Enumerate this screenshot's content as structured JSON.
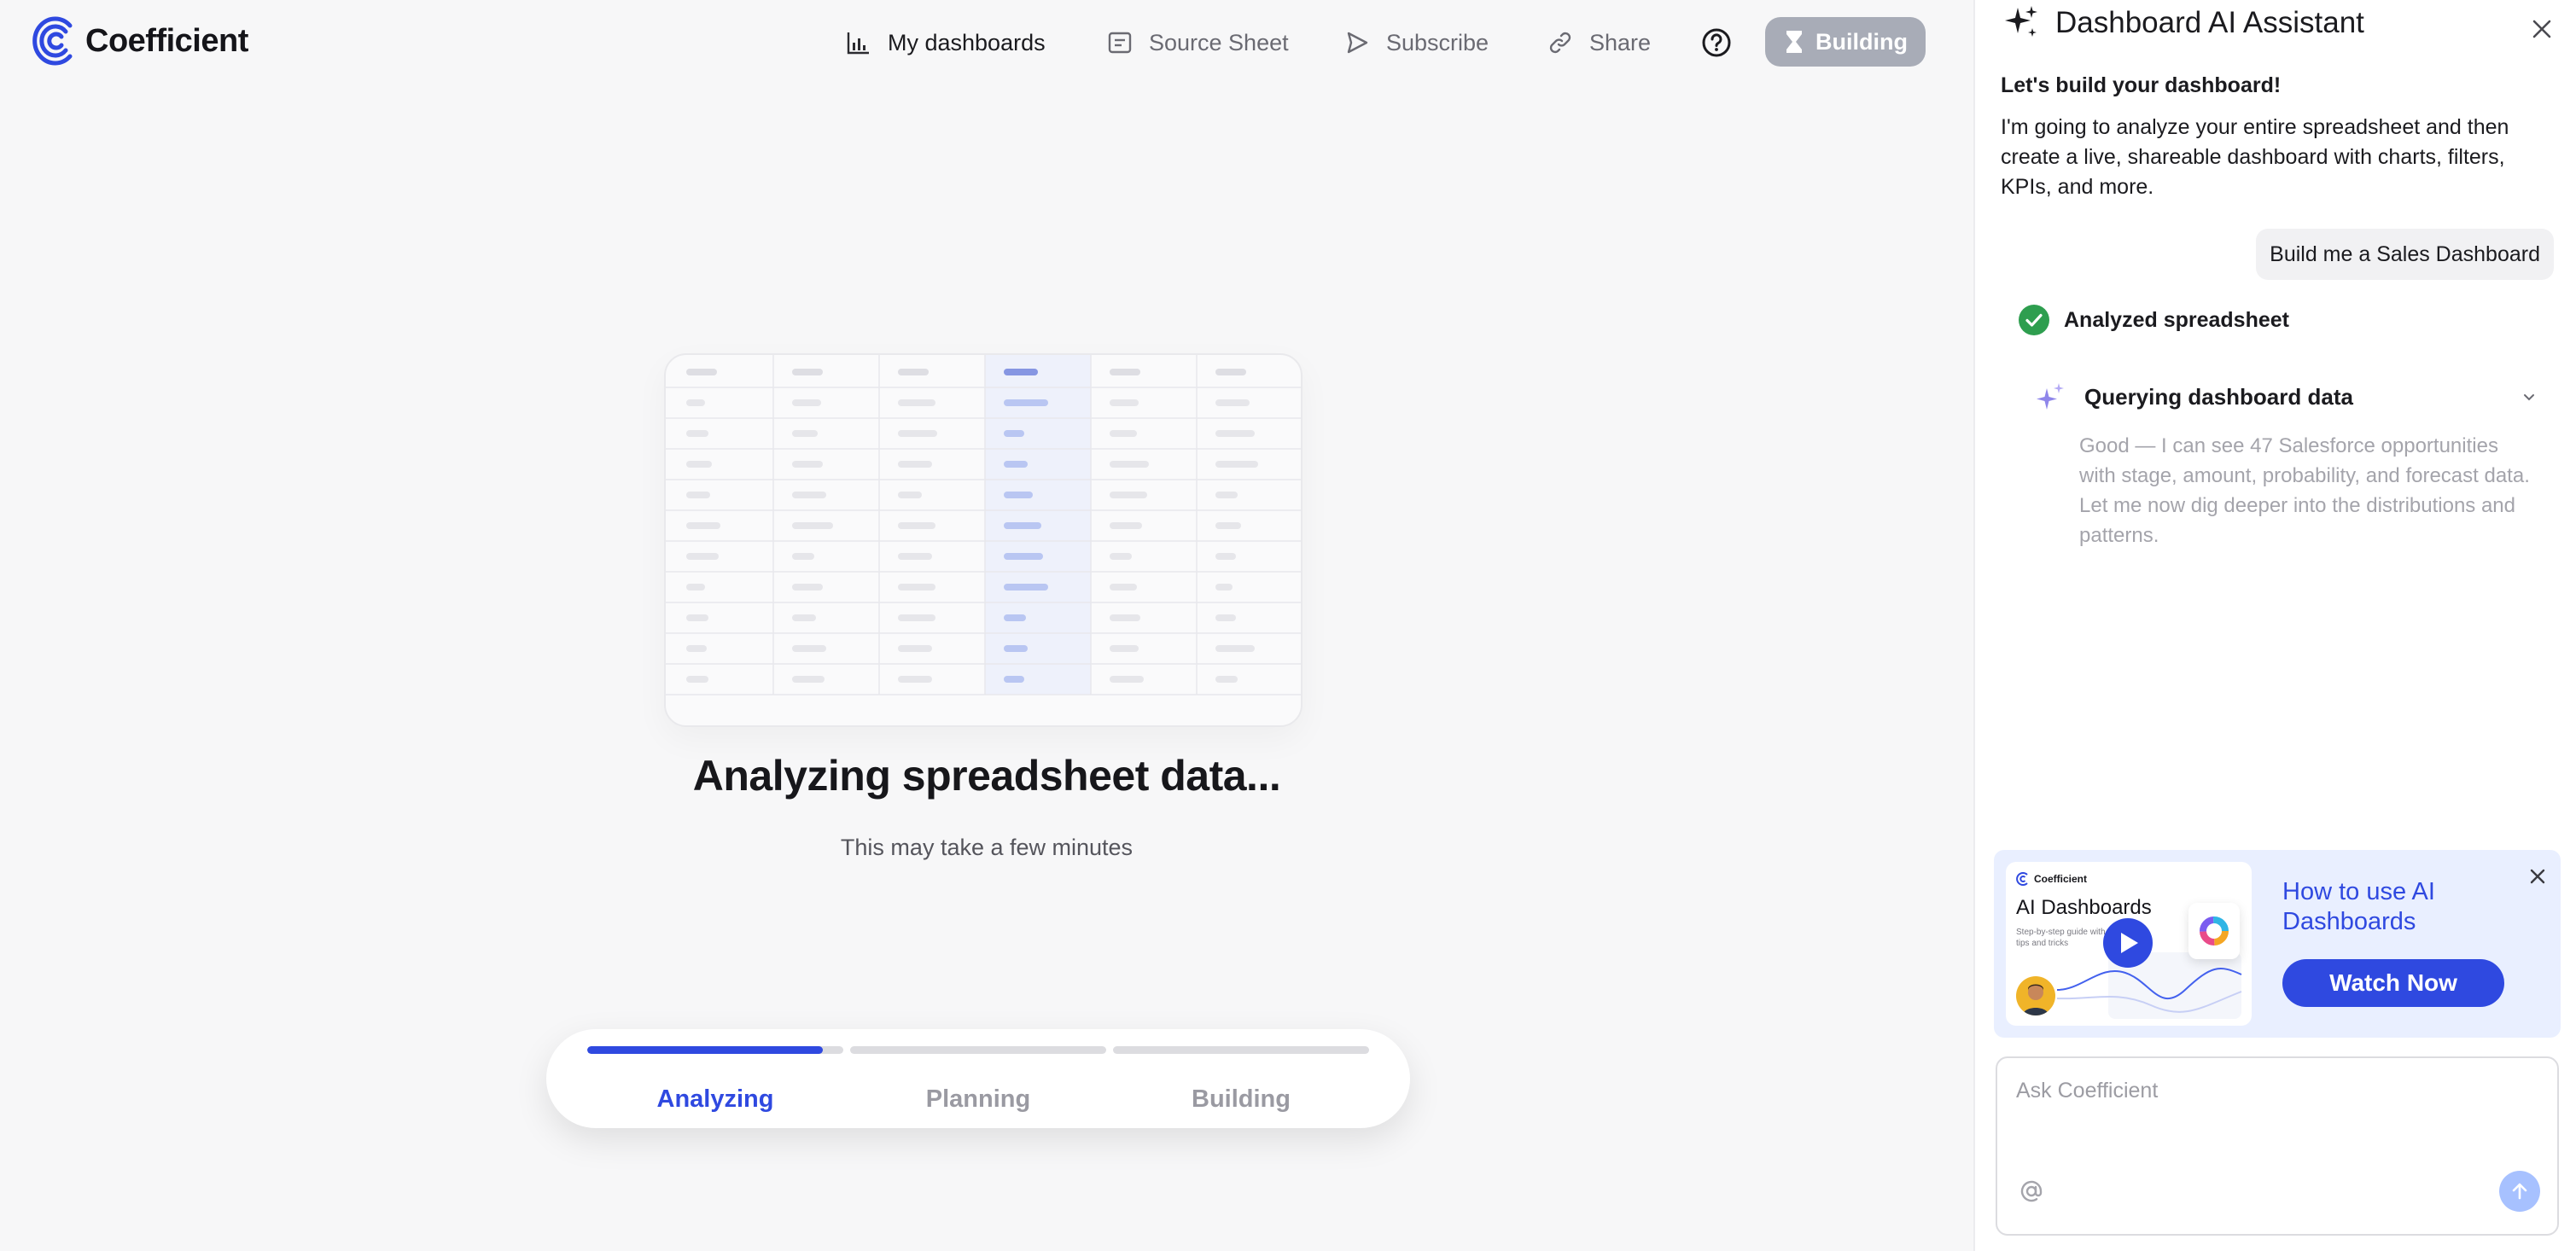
{
  "app": {
    "brand": "Coefficient"
  },
  "nav": {
    "my_dashboards": "My dashboards",
    "source_sheet": "Source Sheet",
    "subscribe": "Subscribe",
    "share": "Share",
    "building_button": "Building"
  },
  "main": {
    "title": "Analyzing spreadsheet data...",
    "subtitle": "This may take a few minutes",
    "steps": [
      {
        "label": "Analyzing",
        "progress": 0.92,
        "state": "current"
      },
      {
        "label": "Planning",
        "progress": 0,
        "state": "pending"
      },
      {
        "label": "Building",
        "progress": 0,
        "state": "pending"
      }
    ]
  },
  "assistant": {
    "title": "Dashboard AI Assistant",
    "intro_heading": "Let's build your dashboard!",
    "intro_body": "I'm going to analyze your entire spreadsheet and then create a live, shareable dashboard with charts, filters, KPIs, and more.",
    "user_message": "Build me a Sales Dashboard",
    "completed_step": "Analyzed spreadsheet",
    "running_step": "Querying dashboard data",
    "running_detail": "Good — I can see 47 Salesforce opportunities with stage, amount, probability, and forecast data. Let me now dig deeper into the distributions and patterns.",
    "promo": {
      "thumb_brand": "Coefficient",
      "thumb_title": "AI Dashboards",
      "thumb_subtitle": "Step-by-step guide with tips and tricks",
      "title": "How to use AI Dashboards",
      "button": "Watch Now"
    },
    "input_placeholder": "Ask Coefficient"
  },
  "colors": {
    "accent": "#2f49e0",
    "success": "#2e9e4f",
    "building_bg": "#a8acb7",
    "promo_bg": "#e9efff"
  }
}
